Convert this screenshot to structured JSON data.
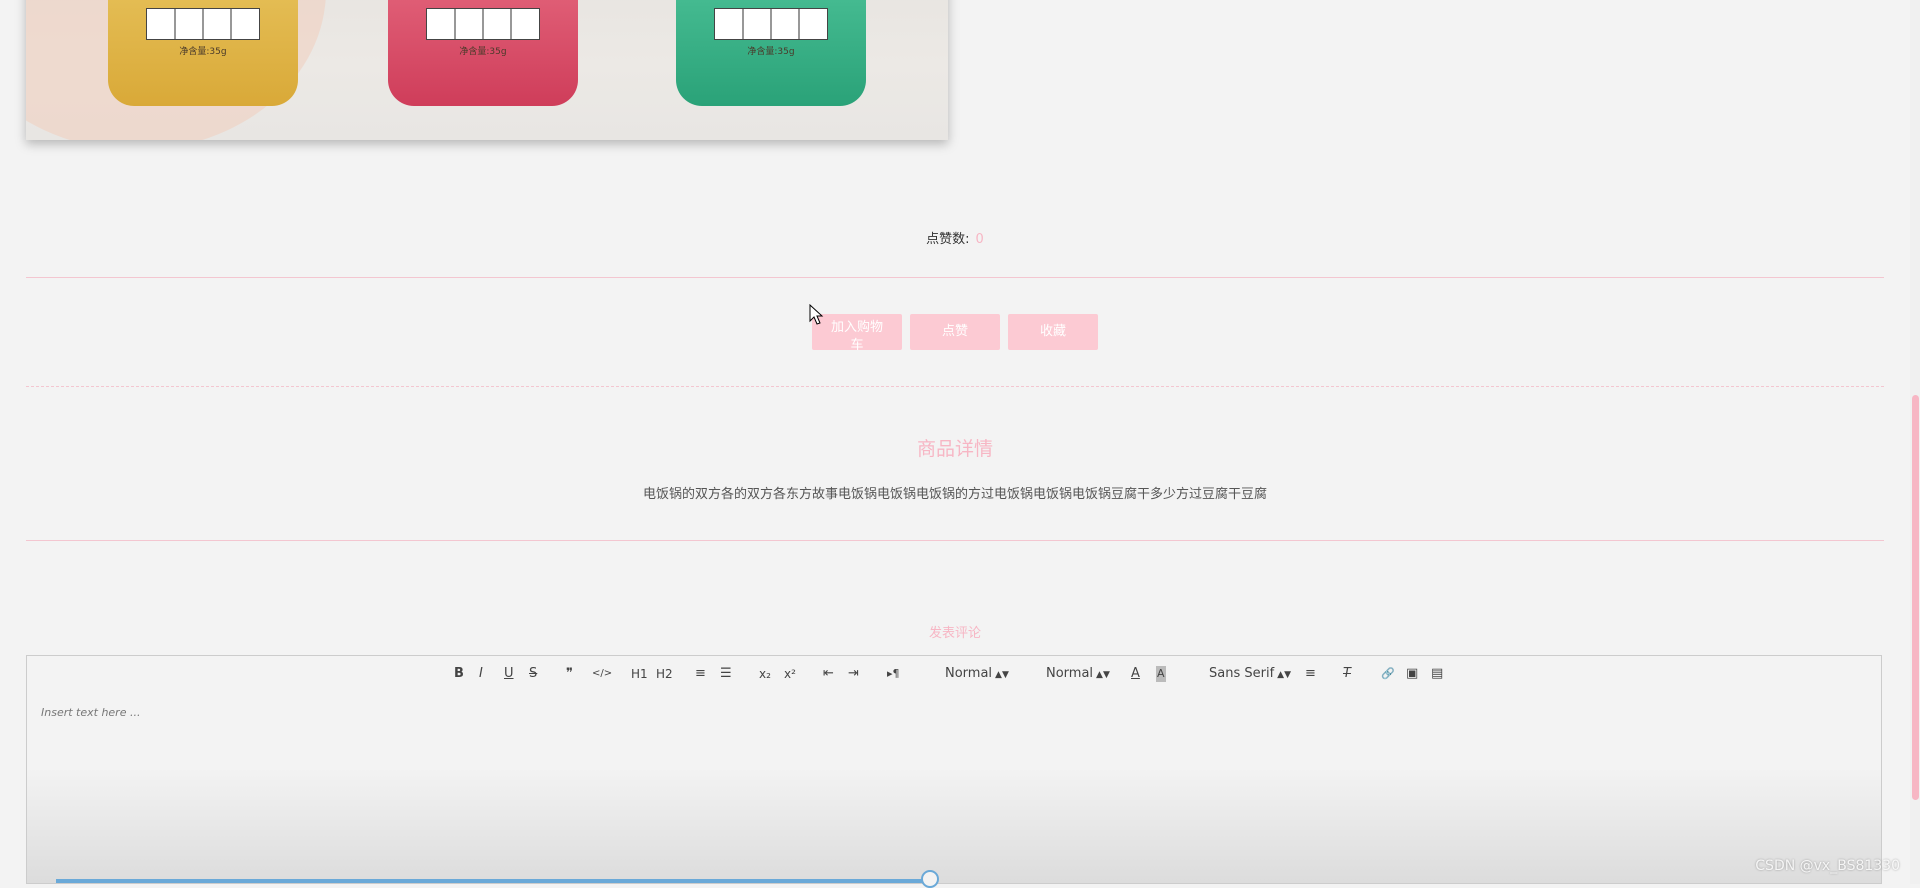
{
  "product_image": {
    "jar_net_weight": "净含量:35g"
  },
  "likes": {
    "label": "点赞数:",
    "count": "0"
  },
  "actions": {
    "add_to_cart_line1": "加入购物",
    "add_to_cart_line2": "车",
    "like": "点赞",
    "favorite": "收藏"
  },
  "detail": {
    "title": "商品详情",
    "description": "电饭锅的双方各的双方各东方故事电饭锅电饭锅电饭锅的方过电饭锅电饭锅电饭锅豆腐干多少方过豆腐干豆腐"
  },
  "comment": {
    "title": "发表评论",
    "toolbar": {
      "bold": "B",
      "italic": "I",
      "underline": "U",
      "strike": "S",
      "blockquote": "❞",
      "code": "</>",
      "h1": "H1",
      "h2": "H2",
      "ordered_list": "≡",
      "bullet_list": "☰",
      "subscript": "x₂",
      "superscript": "x²",
      "outdent": "⇤",
      "indent": "⇥",
      "direction": "▸¶",
      "size_value": "Normal",
      "header_value": "Normal",
      "color": "A",
      "background": "A",
      "font_value": "Sans Serif",
      "align": "≡",
      "clean": "T",
      "link": "🔗",
      "image": "▣",
      "video": "▤"
    },
    "placeholder": "Insert text here ..."
  },
  "watermark": "CSDN @vx_BS81330",
  "colors": {
    "accent_pink": "#f7b6c4",
    "button_pink": "#fccad3",
    "progress_blue": "#6aa9d8"
  }
}
